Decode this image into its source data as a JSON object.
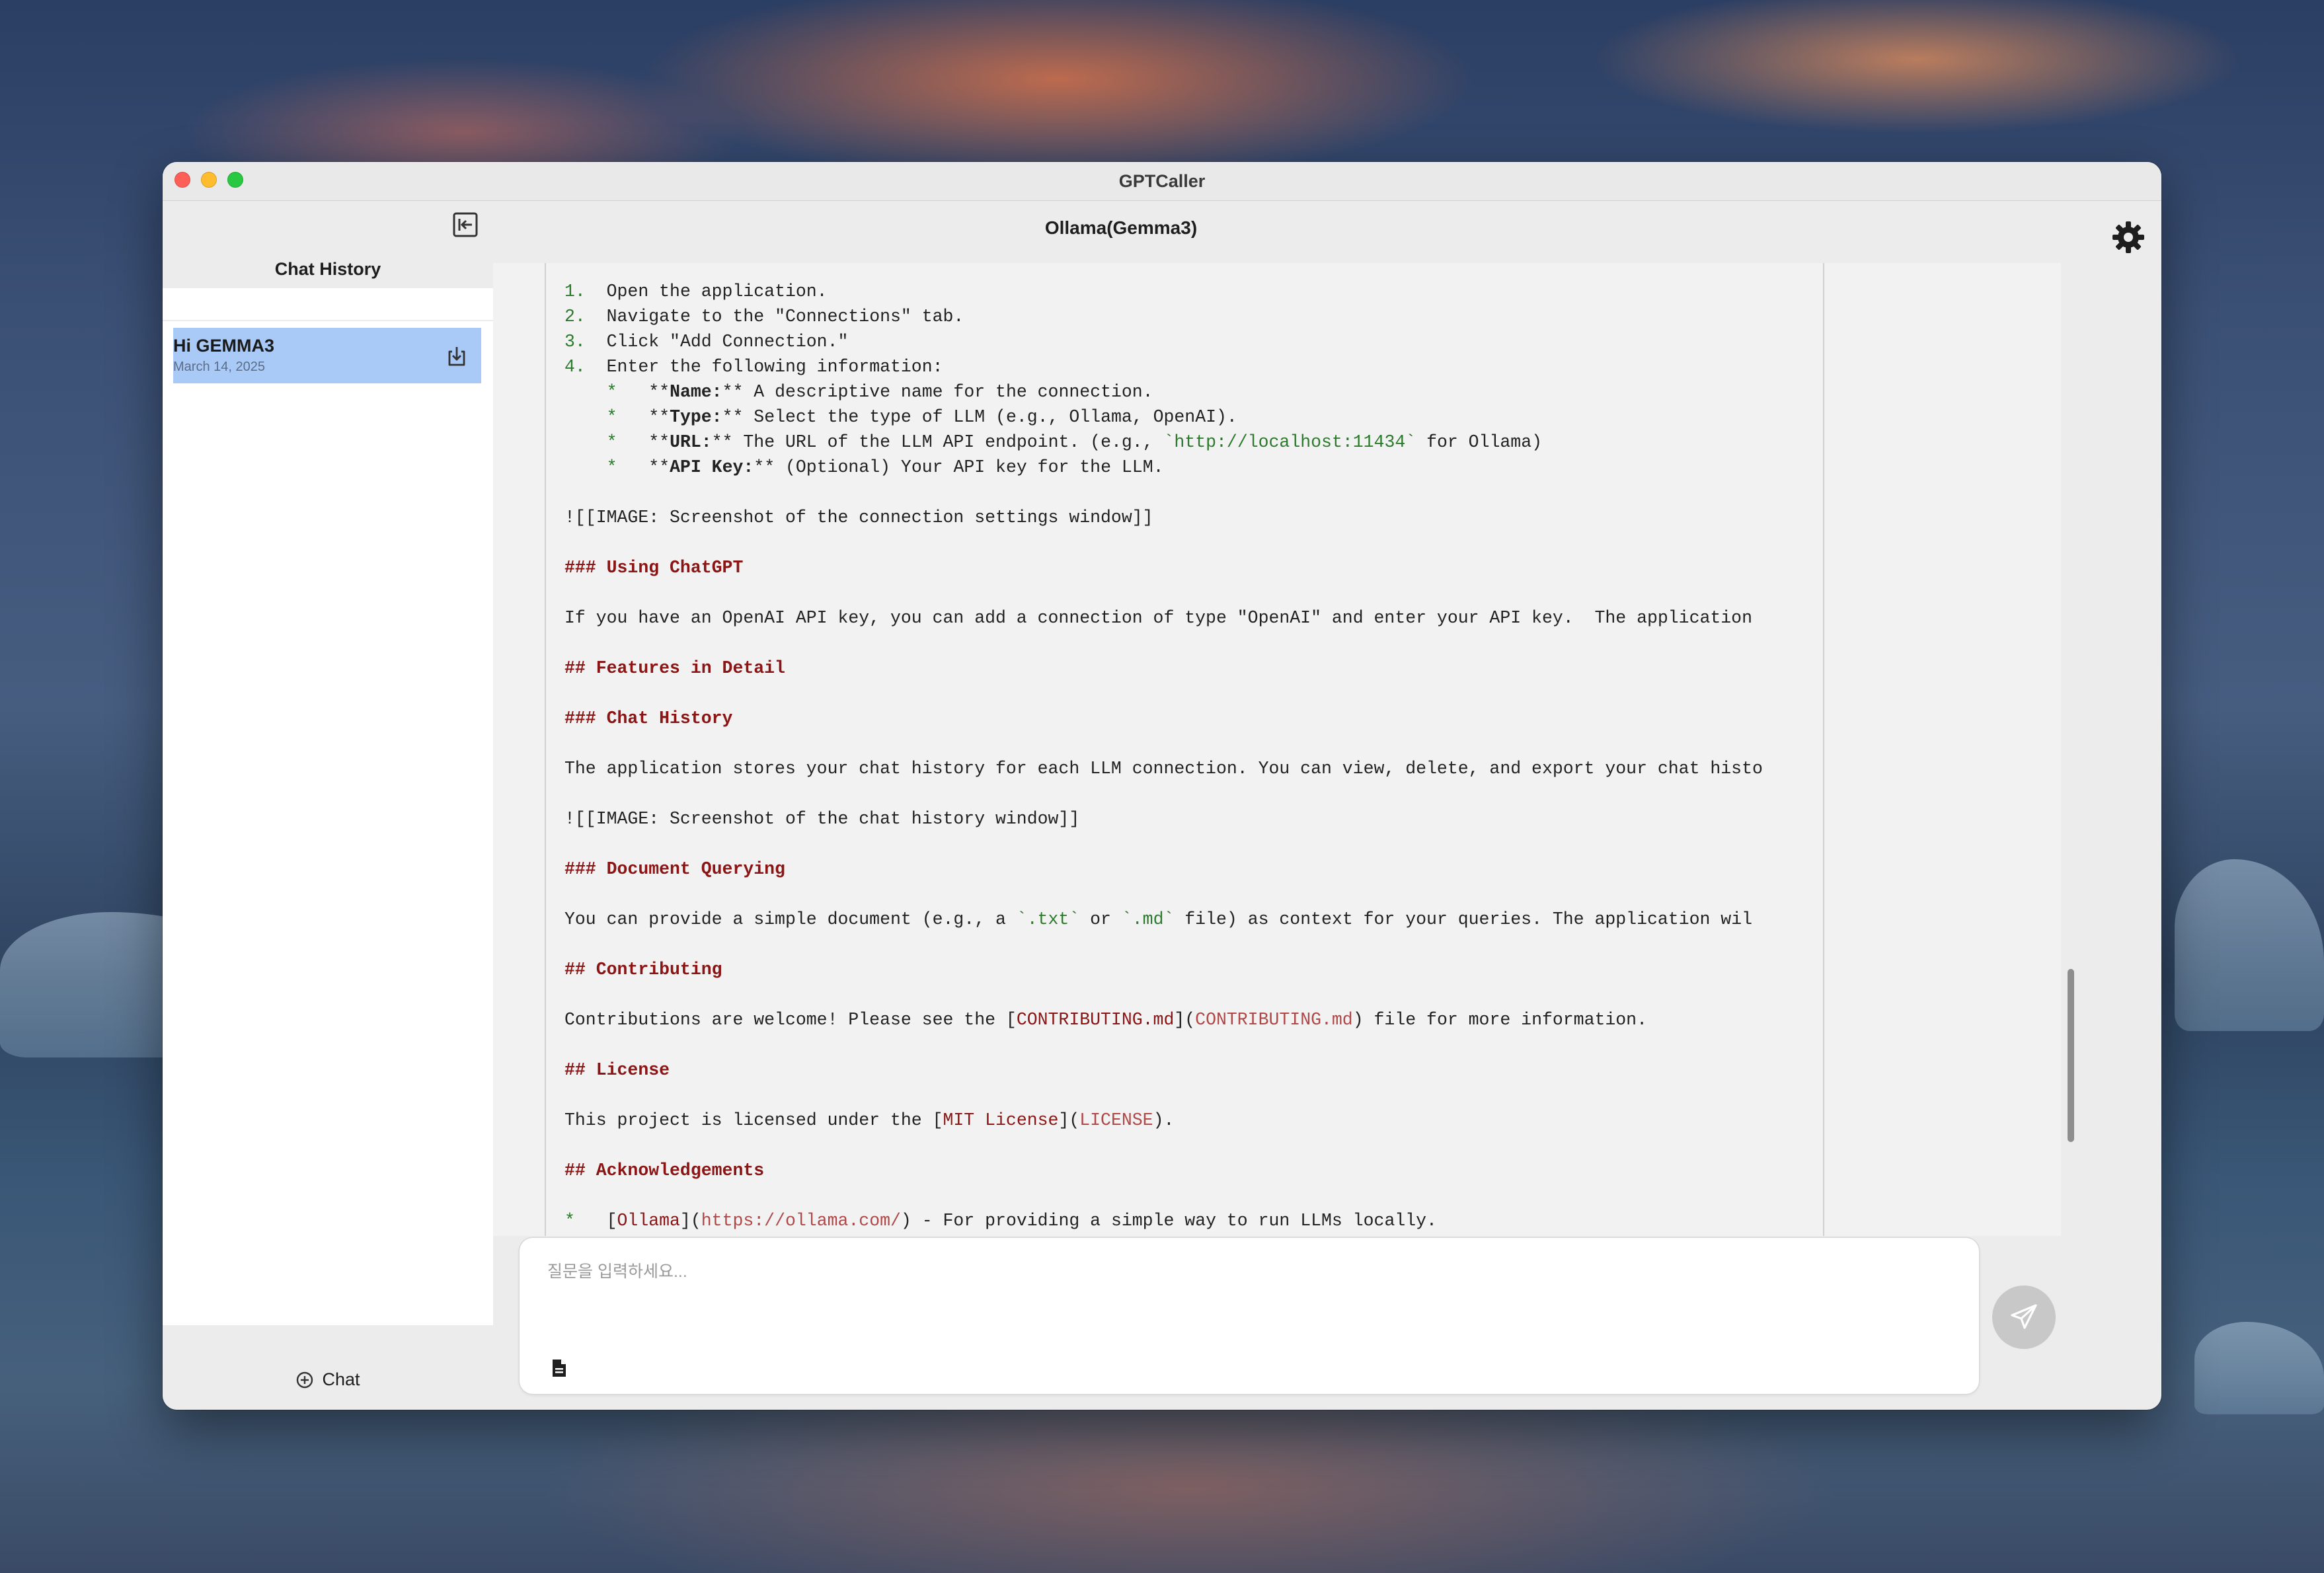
{
  "window": {
    "title": "GPTCaller"
  },
  "sidebar": {
    "title": "Chat History",
    "chats": [
      {
        "title": "Hi GEMMA3",
        "date": "March 14, 2025",
        "selected": true
      }
    ],
    "new_chat_label": "Chat"
  },
  "header": {
    "model_title": "Ollama(Gemma3)"
  },
  "message": {
    "l1_num": "1.",
    "l1_text": "Open the application.",
    "l2_num": "2.",
    "l2_text": "Navigate to the \"Connections\" tab.",
    "l3_num": "3.",
    "l3_text": "Click \"Add Connection.\"",
    "l4_num": "4.",
    "l4_text": "Enter the following information:",
    "b1_bullet": "*",
    "b1_pre": "**",
    "b1_bold": "Name:",
    "b1_post": "** A descriptive name for the connection.",
    "b2_bullet": "*",
    "b2_pre": "**",
    "b2_bold": "Type:",
    "b2_post": "** Select the type of LLM (e.g., Ollama, OpenAI).",
    "b3_bullet": "*",
    "b3_pre": "**",
    "b3_bold": "URL:",
    "b3_mid": "** The URL of the LLM API endpoint. (e.g., ",
    "b3_code": "`http://localhost:11434`",
    "b3_post": " for Ollama)",
    "b4_bullet": "*",
    "b4_pre": "**",
    "b4_bold": "API Key:",
    "b4_post": "** (Optional) Your API key for the LLM.",
    "img1": "![[IMAGE: Screenshot of the connection settings window]]",
    "h_using_chatgpt": "### Using ChatGPT",
    "p_openai": "If you have an OpenAI API key, you can add a connection of type \"OpenAI\" and enter your API key.  The application",
    "h_features": "## Features in Detail",
    "h_chat_history": "### Chat History",
    "p_chat_history": "The application stores your chat history for each LLM connection. You can view, delete, and export your chat histo",
    "img2": "![[IMAGE: Screenshot of the chat history window]]",
    "h_doc_query": "### Document Querying",
    "p_doc_pre": "You can provide a simple document (e.g., a ",
    "p_doc_code1": "`.txt`",
    "p_doc_mid": " or ",
    "p_doc_code2": "`.md`",
    "p_doc_post": " file) as context for your queries. The application wil",
    "h_contributing": "## Contributing",
    "p_contrib_pre": "Contributions are welcome! Please see the [",
    "p_contrib_link": "CONTRIBUTING.md",
    "p_contrib_mid": "](",
    "p_contrib_url": "CONTRIBUTING.md",
    "p_contrib_post": ") file for more information.",
    "h_license": "## License",
    "p_license_pre": "This project is licensed under the [",
    "p_license_link": "MIT License",
    "p_license_mid": "](",
    "p_license_url": "LICENSE",
    "p_license_post": ").",
    "h_ack": "## Acknowledgements",
    "ack_bullet": "*",
    "ack_pre": "[",
    "ack_link": "Ollama",
    "ack_mid": "](",
    "ack_url": "https://ollama.com/",
    "ack_post": ") - For providing a simple way to run LLMs locally."
  },
  "input": {
    "placeholder": "질문을 입력하세요..."
  },
  "icons": {
    "collapse": "sidebar-collapse-icon",
    "export": "export-icon",
    "settings": "gear-icon",
    "attach": "document-icon",
    "send": "paper-plane-icon",
    "new_chat": "plus-circle-icon"
  },
  "colors": {
    "selected_chat": "#a9c9f7",
    "heading": "#8b1515",
    "code": "#2c7a2c",
    "send_disabled": "#c8c8c8"
  }
}
